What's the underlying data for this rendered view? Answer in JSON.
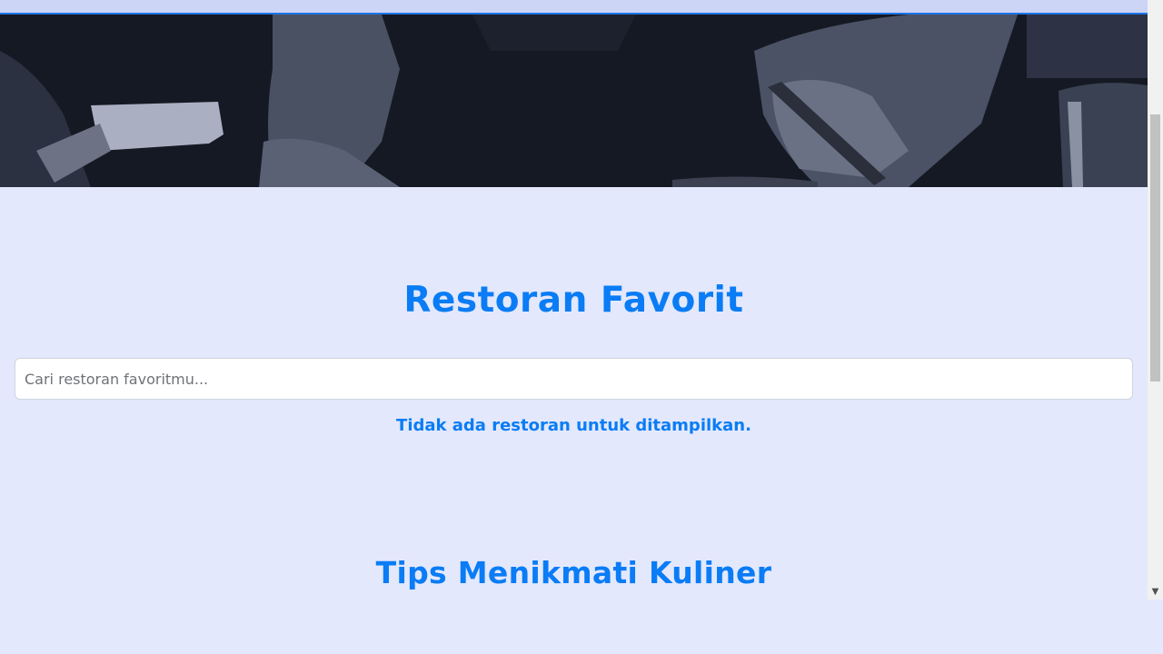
{
  "hero": {
    "image": "restaurant-hands-photo"
  },
  "favorites": {
    "title": "Restoran Favorit",
    "search_placeholder": "Cari restoran favoritmu...",
    "empty_message": "Tidak ada restoran untuk ditampilkan."
  },
  "tips": {
    "title": "Tips Menikmati Kuliner"
  },
  "scrollbar": {
    "down_arrow_icon": "triangle-down-icon"
  },
  "colors": {
    "accent": "#0a7cf5",
    "background": "#e3e8fd",
    "hero_tint": "#141822"
  }
}
